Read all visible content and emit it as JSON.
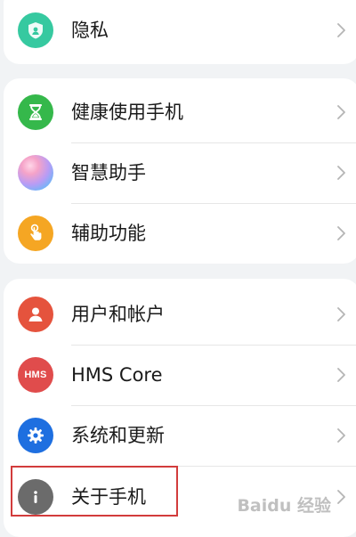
{
  "groups": [
    {
      "items": [
        {
          "label": "隐私",
          "icon": "privacy-shield-icon"
        }
      ]
    },
    {
      "items": [
        {
          "label": "健康使用手机",
          "icon": "hourglass-icon"
        },
        {
          "label": "智慧助手",
          "icon": "smart-assistant-orb-icon"
        },
        {
          "label": "辅助功能",
          "icon": "hand-pointer-icon"
        }
      ]
    },
    {
      "items": [
        {
          "label": "用户和帐户",
          "icon": "user-account-icon"
        },
        {
          "label": "HMS Core",
          "icon": "hms-icon",
          "icon_text": "HMS"
        },
        {
          "label": "系统和更新",
          "icon": "gear-icon"
        },
        {
          "label": "关于手机",
          "icon": "info-icon"
        }
      ]
    }
  ],
  "highlighted_item": "关于手机",
  "watermark": "Baidu 经验",
  "colors": {
    "privacy": "#36c9a0",
    "health": "#35b84b",
    "accessibility": "#f5a623",
    "user": "#e5533d",
    "hms": "#e04c4c",
    "system": "#1e6fe0",
    "about": "#6b6b6b",
    "highlight_border": "#d23c3c"
  }
}
